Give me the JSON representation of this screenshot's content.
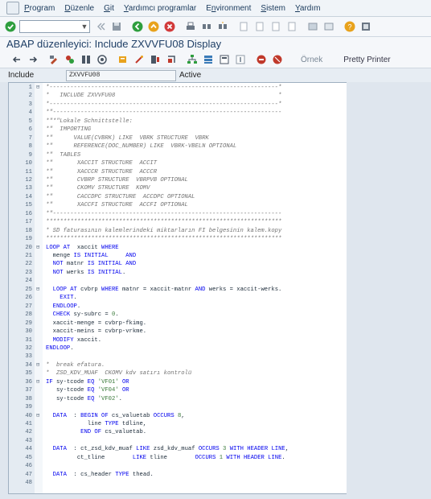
{
  "menu": [
    "Program",
    "Düzenle",
    "Git",
    "Yardımcı programlar",
    "Environment",
    "Sistem",
    "Yardım"
  ],
  "menu_ul": [
    "P",
    "D",
    "G",
    "Y",
    "n",
    "S",
    "Y"
  ],
  "window_title": "ABAP düzenleyici: Include ZXVVFU08 Display",
  "toolbar2": {
    "ornek": "Örnek",
    "pretty_printer": "Pretty Printer"
  },
  "include": {
    "label": "Include",
    "value": "ZXVVFU08",
    "status": "Active"
  },
  "code_lines": [
    {
      "n": "1",
      "f": "⊟",
      "t": [
        [
          "c",
          "*------------------------------------------------------------------*"
        ]
      ]
    },
    {
      "n": "2",
      "f": "",
      "t": [
        [
          "c",
          "*   INCLUDE ZXVVFU08                                               *"
        ]
      ]
    },
    {
      "n": "3",
      "f": "",
      "t": [
        [
          "c",
          "*------------------------------------------------------------------*"
        ]
      ]
    },
    {
      "n": "4",
      "f": "",
      "t": [
        [
          "c",
          "*\"------------------------------------------------------------------"
        ]
      ]
    },
    {
      "n": "5",
      "f": "",
      "t": [
        [
          "c",
          "*\"*\"Lokale Schnittstelle:"
        ]
      ]
    },
    {
      "n": "6",
      "f": "",
      "t": [
        [
          "c",
          "*\"  IMPORTING"
        ]
      ]
    },
    {
      "n": "7",
      "f": "",
      "t": [
        [
          "c",
          "*\"      VALUE(CVBRK) LIKE  VBRK STRUCTURE  VBRK"
        ]
      ]
    },
    {
      "n": "8",
      "f": "",
      "t": [
        [
          "c",
          "*\"      REFERENCE(DOC_NUMBER) LIKE  VBRK-VBELN OPTIONAL"
        ]
      ]
    },
    {
      "n": "9",
      "f": "",
      "t": [
        [
          "c",
          "*\"  TABLES"
        ]
      ]
    },
    {
      "n": "10",
      "f": "",
      "t": [
        [
          "c",
          "*\"       XACCIT STRUCTURE  ACCIT"
        ]
      ]
    },
    {
      "n": "11",
      "f": "",
      "t": [
        [
          "c",
          "*\"       XACCCR STRUCTURE  ACCCR"
        ]
      ]
    },
    {
      "n": "12",
      "f": "",
      "t": [
        [
          "c",
          "*\"       CVBRP STRUCTURE  VBRPVB OPTIONAL"
        ]
      ]
    },
    {
      "n": "13",
      "f": "",
      "t": [
        [
          "c",
          "*\"       CKOMV STRUCTURE  KOMV"
        ]
      ]
    },
    {
      "n": "14",
      "f": "",
      "t": [
        [
          "c",
          "*\"       CACCDPC STRUCTURE  ACCDPC OPTIONAL"
        ]
      ]
    },
    {
      "n": "15",
      "f": "",
      "t": [
        [
          "c",
          "*\"       XACCFI STRUCTURE  ACCFI OPTIONAL"
        ]
      ]
    },
    {
      "n": "16",
      "f": "",
      "t": [
        [
          "c",
          "*\"------------------------------------------------------------------"
        ]
      ]
    },
    {
      "n": "17",
      "f": "",
      "t": [
        [
          "c",
          "********************************************************************"
        ]
      ]
    },
    {
      "n": "18",
      "f": "",
      "t": [
        [
          "c",
          "* SD faturasının kalemlerindeki miktarların FI belgesinin kalem.kopy"
        ]
      ]
    },
    {
      "n": "19",
      "f": "",
      "t": [
        [
          "c",
          "********************************************************************"
        ]
      ]
    },
    {
      "n": "20",
      "f": "⊟",
      "t": [
        [
          "k",
          "LOOP AT"
        ],
        [
          "",
          "  xaccit "
        ],
        [
          "k",
          "WHERE"
        ]
      ]
    },
    {
      "n": "21",
      "f": "",
      "t": [
        [
          "",
          "  menge "
        ],
        [
          "k",
          "IS INITIAL"
        ],
        [
          "",
          "     "
        ],
        [
          "k",
          "AND"
        ]
      ]
    },
    {
      "n": "22",
      "f": "",
      "t": [
        [
          "",
          "  "
        ],
        [
          "k",
          "NOT"
        ],
        [
          "",
          " matnr "
        ],
        [
          "k",
          "IS INITIAL AND"
        ]
      ]
    },
    {
      "n": "23",
      "f": "",
      "t": [
        [
          "",
          "  "
        ],
        [
          "k",
          "NOT"
        ],
        [
          "",
          " werks "
        ],
        [
          "k",
          "IS INITIAL"
        ],
        [
          "",
          "."
        ]
      ]
    },
    {
      "n": "24",
      "f": "",
      "t": [
        [
          "",
          ""
        ]
      ]
    },
    {
      "n": "25",
      "f": "⊟",
      "t": [
        [
          "",
          "  "
        ],
        [
          "k",
          "LOOP AT"
        ],
        [
          "",
          " cvbrp "
        ],
        [
          "k",
          "WHERE"
        ],
        [
          "",
          " matnr = xaccit-matnr "
        ],
        [
          "k",
          "AND"
        ],
        [
          "",
          " werks = xaccit-werks."
        ]
      ]
    },
    {
      "n": "26",
      "f": "",
      "t": [
        [
          "",
          "    "
        ],
        [
          "k",
          "EXIT"
        ],
        [
          "",
          "."
        ]
      ]
    },
    {
      "n": "27",
      "f": "",
      "t": [
        [
          "",
          "  "
        ],
        [
          "k",
          "ENDLOOP"
        ],
        [
          "",
          "."
        ]
      ]
    },
    {
      "n": "28",
      "f": "",
      "t": [
        [
          "",
          "  "
        ],
        [
          "k",
          "CHECK"
        ],
        [
          "",
          " sy-subrc = "
        ],
        [
          "n",
          "0"
        ],
        [
          "",
          "."
        ]
      ]
    },
    {
      "n": "29",
      "f": "",
      "t": [
        [
          "",
          "  xaccit-menge = cvbrp-fkimg."
        ]
      ]
    },
    {
      "n": "30",
      "f": "",
      "t": [
        [
          "",
          "  xaccit-meins = cvbrp-vrkme."
        ]
      ]
    },
    {
      "n": "31",
      "f": "",
      "t": [
        [
          "",
          "  "
        ],
        [
          "k",
          "MODIFY"
        ],
        [
          "",
          " xaccit."
        ]
      ]
    },
    {
      "n": "32",
      "f": "",
      "t": [
        [
          "k",
          "ENDLOOP"
        ],
        [
          "",
          "."
        ]
      ]
    },
    {
      "n": "33",
      "f": "",
      "t": [
        [
          "",
          ""
        ]
      ]
    },
    {
      "n": "34",
      "f": "⊟",
      "t": [
        [
          "c",
          "*  break efatura."
        ]
      ]
    },
    {
      "n": "35",
      "f": "",
      "t": [
        [
          "c",
          "*  ZSD_KDV_MUAF  CKOMV kdv satırı kontrolü"
        ]
      ]
    },
    {
      "n": "36",
      "f": "⊟",
      "t": [
        [
          "k",
          "IF"
        ],
        [
          "",
          " sy-tcode "
        ],
        [
          "k",
          "EQ"
        ],
        [
          "",
          " "
        ],
        [
          "s",
          "'VF01'"
        ],
        [
          "",
          " "
        ],
        [
          "k",
          "OR"
        ]
      ]
    },
    {
      "n": "37",
      "f": "",
      "t": [
        [
          "",
          "   sy-tcode "
        ],
        [
          "k",
          "EQ"
        ],
        [
          "",
          " "
        ],
        [
          "s",
          "'VF04'"
        ],
        [
          "",
          " "
        ],
        [
          "k",
          "OR"
        ]
      ]
    },
    {
      "n": "38",
      "f": "",
      "t": [
        [
          "",
          "   sy-tcode "
        ],
        [
          "k",
          "EQ"
        ],
        [
          "",
          " "
        ],
        [
          "s",
          "'VF02'"
        ],
        [
          "",
          "."
        ]
      ]
    },
    {
      "n": "39",
      "f": "",
      "t": [
        [
          "",
          ""
        ]
      ]
    },
    {
      "n": "40",
      "f": "⊟",
      "t": [
        [
          "",
          "  "
        ],
        [
          "k",
          "DATA"
        ],
        [
          "",
          "  : "
        ],
        [
          "k",
          "BEGIN OF"
        ],
        [
          "",
          " cs_valuetab "
        ],
        [
          "k",
          "OCCURS"
        ],
        [
          "",
          " "
        ],
        [
          "n",
          "8"
        ],
        [
          "",
          ","
        ]
      ]
    },
    {
      "n": "41",
      "f": "",
      "t": [
        [
          "",
          "            line "
        ],
        [
          "k",
          "TYPE"
        ],
        [
          "",
          " tdline,"
        ]
      ]
    },
    {
      "n": "42",
      "f": "",
      "t": [
        [
          "",
          "          "
        ],
        [
          "k",
          "END OF"
        ],
        [
          "",
          " cs_valuetab."
        ]
      ]
    },
    {
      "n": "43",
      "f": "",
      "t": [
        [
          "",
          ""
        ]
      ]
    },
    {
      "n": "44",
      "f": "",
      "t": [
        [
          "",
          "  "
        ],
        [
          "k",
          "DATA"
        ],
        [
          "",
          "  : ct_zsd_kdv_muaf "
        ],
        [
          "k",
          "LIKE"
        ],
        [
          "",
          " zsd_kdv_muaf "
        ],
        [
          "k",
          "OCCURS"
        ],
        [
          "",
          " "
        ],
        [
          "n",
          "3"
        ],
        [
          "",
          " "
        ],
        [
          "k",
          "WITH HEADER LINE"
        ],
        [
          "",
          ","
        ]
      ]
    },
    {
      "n": "45",
      "f": "",
      "t": [
        [
          "",
          "         ct_tline        "
        ],
        [
          "k",
          "LIKE"
        ],
        [
          "",
          " tline        "
        ],
        [
          "k",
          "OCCURS"
        ],
        [
          "",
          " "
        ],
        [
          "n",
          "1"
        ],
        [
          "",
          " "
        ],
        [
          "k",
          "WITH HEADER LINE"
        ],
        [
          "",
          "."
        ]
      ]
    },
    {
      "n": "46",
      "f": "",
      "t": [
        [
          "",
          ""
        ]
      ]
    },
    {
      "n": "47",
      "f": "",
      "t": [
        [
          "",
          "  "
        ],
        [
          "k",
          "DATA"
        ],
        [
          "",
          "  : cs_header "
        ],
        [
          "k",
          "TYPE"
        ],
        [
          "",
          " thead."
        ]
      ]
    },
    {
      "n": "48",
      "f": "",
      "t": [
        [
          "",
          ""
        ]
      ]
    }
  ],
  "colors": {
    "keyword": "#0000ee",
    "comment": "#727272",
    "literal": "#3a7a3a",
    "gutter": "#e4ebf2"
  }
}
